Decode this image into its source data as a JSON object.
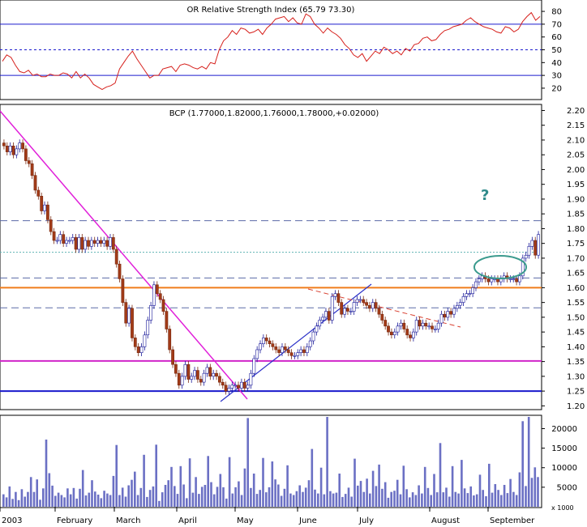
{
  "chart_data": [
    {
      "type": "line",
      "panel": "indicator",
      "title": "Relative Strength Index",
      "title_overlay_text": "OR Relative Strength Index (65.79 73.30)",
      "y_ticks": [
        80,
        70,
        60,
        50,
        40,
        30,
        20
      ],
      "ylim": [
        13,
        87
      ],
      "reference_lines": [
        70,
        50,
        30
      ],
      "series": [
        {
          "values": [
            41,
            46,
            44,
            38,
            33,
            32,
            34,
            30,
            31,
            29,
            29,
            31,
            30,
            30,
            32,
            31,
            28,
            33,
            28,
            31,
            28,
            23,
            21,
            19,
            21,
            22,
            24,
            35,
            40,
            45,
            49,
            43,
            38,
            33,
            28,
            30,
            30,
            35,
            36,
            37,
            33,
            38,
            39,
            38,
            36,
            35,
            37,
            35,
            40,
            39,
            50,
            57,
            60,
            65,
            62,
            67,
            66,
            63,
            64,
            66,
            62,
            67,
            70,
            74,
            75,
            76,
            72,
            75,
            71,
            70,
            78,
            76,
            70,
            67,
            63,
            67,
            64,
            62,
            59,
            54,
            51,
            46,
            44,
            47,
            41,
            45,
            49,
            47,
            52,
            50,
            47,
            49,
            46,
            51,
            49,
            54,
            55,
            59,
            60,
            57,
            58,
            62,
            65,
            66,
            68,
            69,
            70,
            73,
            75,
            72,
            70,
            68,
            67,
            66,
            64,
            63,
            68,
            67,
            64,
            66,
            72,
            76,
            79,
            73,
            76
          ]
        }
      ]
    },
    {
      "type": "candlestick",
      "panel": "price",
      "title": "BCP (1.77000,1.82000,1.76000,1.78000,+0.02000)",
      "y_ticks": [
        "2.20",
        "2.15",
        "2.10",
        "2.05",
        "2.00",
        "1.95",
        "1.90",
        "1.85",
        "1.80",
        "1.75",
        "1.70",
        "1.65",
        "1.60",
        "1.55",
        "1.50",
        "1.45",
        "1.40",
        "1.35",
        "1.30",
        "1.25",
        "1.20"
      ],
      "ylim": [
        1.19,
        2.215
      ],
      "closes": [
        2.08,
        2.06,
        2.08,
        2.05,
        2.07,
        2.09,
        2.07,
        2.03,
        2.02,
        1.98,
        1.93,
        1.91,
        1.86,
        1.88,
        1.83,
        1.79,
        1.76,
        1.76,
        1.78,
        1.75,
        1.76,
        1.76,
        1.77,
        1.73,
        1.77,
        1.73,
        1.76,
        1.74,
        1.76,
        1.75,
        1.76,
        1.75,
        1.76,
        1.74,
        1.77,
        1.73,
        1.68,
        1.63,
        1.55,
        1.48,
        1.53,
        1.43,
        1.4,
        1.38,
        1.4,
        1.44,
        1.49,
        1.54,
        1.61,
        1.58,
        1.56,
        1.52,
        1.46,
        1.39,
        1.34,
        1.31,
        1.27,
        1.3,
        1.34,
        1.29,
        1.3,
        1.32,
        1.29,
        1.28,
        1.31,
        1.33,
        1.3,
        1.31,
        1.3,
        1.28,
        1.27,
        1.25,
        1.26,
        1.27,
        1.27,
        1.26,
        1.28,
        1.26,
        1.27,
        1.31,
        1.36,
        1.39,
        1.41,
        1.43,
        1.42,
        1.41,
        1.4,
        1.39,
        1.38,
        1.4,
        1.39,
        1.38,
        1.37,
        1.37,
        1.38,
        1.39,
        1.38,
        1.4,
        1.42,
        1.45,
        1.47,
        1.49,
        1.5,
        1.52,
        1.49,
        1.57,
        1.58,
        1.55,
        1.51,
        1.53,
        1.52,
        1.52,
        1.55,
        1.56,
        1.56,
        1.55,
        1.54,
        1.53,
        1.55,
        1.53,
        1.51,
        1.49,
        1.47,
        1.45,
        1.44,
        1.45,
        1.47,
        1.48,
        1.46,
        1.44,
        1.43,
        1.45,
        1.49,
        1.47,
        1.48,
        1.47,
        1.47,
        1.46,
        1.46,
        1.48,
        1.51,
        1.5,
        1.52,
        1.51,
        1.53,
        1.54,
        1.55,
        1.57,
        1.58,
        1.58,
        1.6,
        1.62,
        1.63,
        1.64,
        1.63,
        1.62,
        1.63,
        1.63,
        1.62,
        1.63,
        1.64,
        1.63,
        1.63,
        1.63,
        1.62,
        1.64,
        1.7,
        1.71,
        1.74,
        1.76,
        1.71,
        1.78
      ],
      "horizontal_lines": [
        {
          "value": 1.827,
          "color": "#5b6aa7",
          "style": "dashed"
        },
        {
          "value": 1.72,
          "color": "#5fb3b3",
          "style": "dotted"
        },
        {
          "value": 1.633,
          "color": "#5b6aa7",
          "style": "dashed"
        },
        {
          "value": 1.6,
          "color": "#f07d1c",
          "style": "solid"
        },
        {
          "value": 1.532,
          "color": "#5b6aa7",
          "style": "dashed"
        },
        {
          "value": 1.352,
          "color": "#d024c9",
          "style": "solid"
        },
        {
          "value": 1.25,
          "color": "#1a1acd",
          "style": "solid"
        }
      ],
      "annotations": {
        "question_mark": "?"
      },
      "colors": {
        "up": "#ffffff",
        "down": "#a23b18",
        "downtrend_line": "#e01fd9",
        "uptrend_line": "#2a30c8",
        "resistance_dash": "#d94030",
        "ellipse": "#3b9b8e",
        "question_mark": "#2e8a8a"
      }
    },
    {
      "type": "bar",
      "panel": "volume",
      "y_ticks": [
        "20000",
        "15000",
        "10000",
        "5000"
      ],
      "ylim": [
        0,
        23000
      ],
      "unit_label": "x 1000",
      "x_labels": [
        "2003",
        "February",
        "March",
        "April",
        "May",
        "June",
        "July",
        "August",
        "September"
      ],
      "values": [
        3200,
        2400,
        5200,
        2000,
        3800,
        1700,
        4500,
        2600,
        3800,
        7600,
        3800,
        7000,
        1800,
        4700,
        17200,
        8600,
        5400,
        2800,
        3600,
        3000,
        2400,
        4700,
        3200,
        4800,
        2100,
        4600,
        9400,
        2900,
        3600,
        6800,
        3900,
        3100,
        2200,
        4100,
        3400,
        3000,
        7900,
        15800,
        3000,
        4900,
        2600,
        5500,
        6900,
        9000,
        3000,
        4800,
        13300,
        2500,
        4300,
        5200,
        15900,
        1500,
        3700,
        5600,
        6800,
        10200,
        5300,
        3300,
        10400,
        5700,
        2200,
        12400,
        3600,
        7600,
        3300,
        5100,
        5600,
        13000,
        6300,
        3200,
        5100,
        8400,
        5000,
        2100,
        12700,
        3400,
        5000,
        6500,
        3000,
        9800,
        22700,
        4800,
        8500,
        3300,
        4300,
        12500,
        3700,
        5000,
        11600,
        7000,
        5700,
        2800,
        4600,
        10600,
        3400,
        3000,
        4000,
        5500,
        3800,
        4900,
        6800,
        14800,
        4400,
        3400,
        10000,
        3200,
        23000,
        4000,
        3400,
        3600,
        8500,
        2500,
        3300,
        4900,
        2600,
        12300,
        5400,
        6600,
        3800,
        7200,
        3400,
        9200,
        5300,
        10800,
        4600,
        6300,
        2300,
        3800,
        4100,
        6900,
        3200,
        10500,
        4500,
        2400,
        3700,
        3000,
        5500,
        3400,
        10200,
        4800,
        3000,
        8400,
        3700,
        16300,
        3700,
        4900,
        2600,
        10400,
        3800,
        3400,
        12000,
        4700,
        3500,
        5200,
        2900,
        3200,
        8200,
        4300,
        2700,
        11000,
        3600,
        5800,
        4300,
        3000,
        5600,
        3500,
        7100,
        3800,
        3000,
        8800,
        21900,
        5300,
        23000,
        7400,
        10100,
        7600
      ]
    }
  ]
}
